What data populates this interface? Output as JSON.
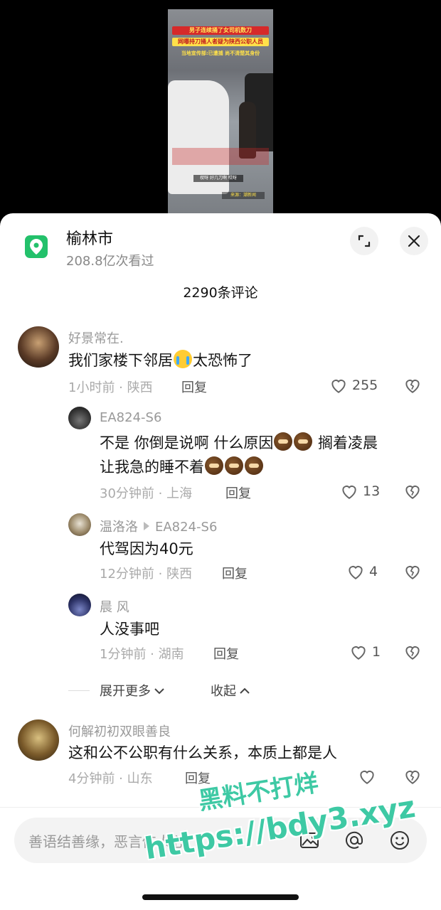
{
  "video": {
    "banner1": "男子连续捅了女司机数刀",
    "banner2": "网曝持刀捅人者疑为陕西公职人员",
    "banner3": "当地宣传部:已遭捕 尚不清楚其身份",
    "subtitle": "杈呀 好几刀啊 哎呀",
    "source": "来源：潮新闻"
  },
  "header": {
    "location_title": "榆林市",
    "views": "208.8亿次看过",
    "comment_count": "2290条评论"
  },
  "comments": [
    {
      "user": "好景常在.",
      "text_before": "我们家楼下邻居",
      "text_after": "太恐怖了",
      "time_loc": "1小时前 · 陕西",
      "reply_label": "回复",
      "likes": "255"
    },
    {
      "user": "EA824-S6",
      "text_line1": "不是 你倒是说啊 什么原因",
      "text_line1_tail": " 搁着凌晨",
      "text_line2": "让我急的睡不着",
      "time_loc": "30分钟前 · 上海",
      "reply_label": "回复",
      "likes": "13"
    },
    {
      "user": "温洛洛",
      "reply_to": "EA824-S6",
      "text": "代驾因为40元",
      "time_loc": "12分钟前 · 陕西",
      "reply_label": "回复",
      "likes": "4"
    },
    {
      "user": "晨 风",
      "text": "人没事吧",
      "time_loc": "1分钟前 · 湖南",
      "reply_label": "回复",
      "likes": "1"
    },
    {
      "user": "何解初初双眼善良",
      "text": "这和公不公职有什么关系，本质上都是人",
      "time_loc": "4分钟前 · 山东",
      "reply_label": "回复"
    }
  ],
  "thread_controls": {
    "expand_more": "展开更多",
    "collapse": "收起"
  },
  "input": {
    "placeholder": "善语结善缘，恶言伤人心"
  },
  "watermark": {
    "line1": "黑料不打烊",
    "line2": "https://bdy3.xyz"
  },
  "colors": {
    "location_icon": "#23c16b",
    "watermark": "#3ec9a4"
  }
}
